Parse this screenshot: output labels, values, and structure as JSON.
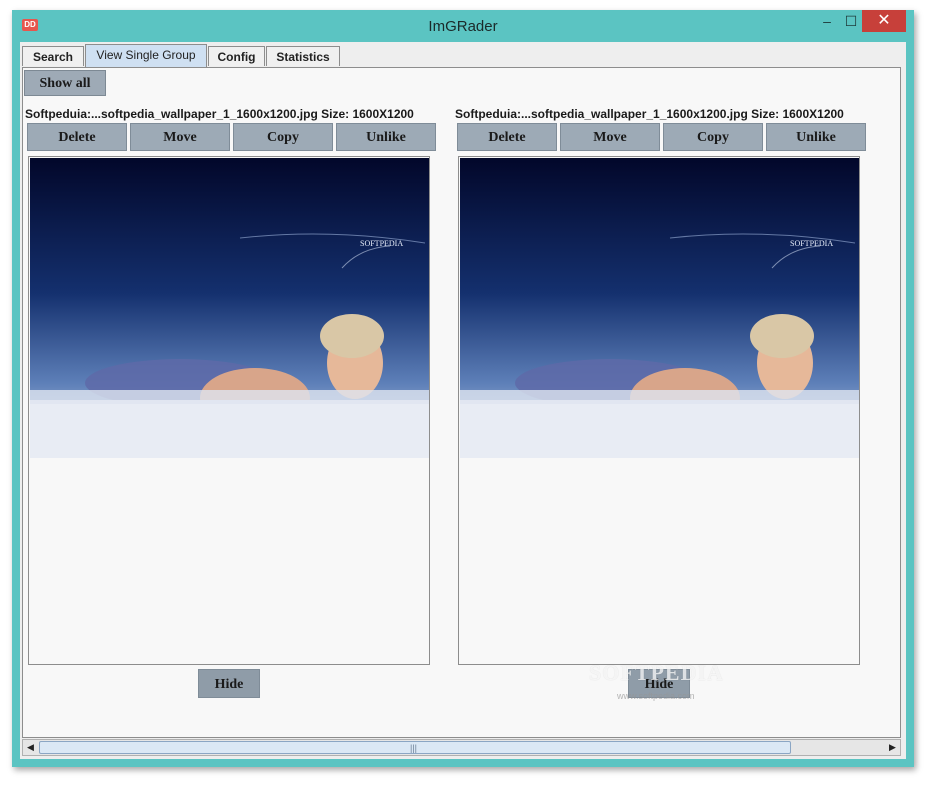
{
  "window": {
    "title": "ImGRader",
    "app_icon_text": "DD",
    "minimize_icon": "minimize-icon",
    "maximize_icon": "maximize-icon",
    "close_icon": "close-icon",
    "minimize_glyph": "–",
    "maximize_glyph": "☐",
    "close_glyph": "✕"
  },
  "tabs": [
    {
      "label": "Search",
      "active": false
    },
    {
      "label": "View Single Group",
      "active": true
    },
    {
      "label": "Config",
      "active": false
    },
    {
      "label": "Statistics",
      "active": false
    }
  ],
  "toolbar": {
    "show_all_label": "Show all"
  },
  "left": {
    "info": "Softpeduia:...softpedia_wallpaper_1_1600x1200.jpg  Size: 1600X1200",
    "buttons": [
      "Delete",
      "Move",
      "Copy",
      "Unlike"
    ],
    "hide_label": "Hide",
    "image_text": "SOFTPEDIA"
  },
  "right": {
    "info": "Softpeduia:...softpedia_wallpaper_1_1600x1200.jpg  Size: 1600X1200",
    "buttons": [
      "Delete",
      "Move",
      "Copy",
      "Unlike"
    ],
    "hide_label": "Hide",
    "image_text": "SOFTPEDIA"
  },
  "watermark": {
    "text": "SOFTPEDIA",
    "sub": "www.softpedia.com"
  },
  "scrollbar": {
    "left_arrow": "◀",
    "right_arrow": "▶",
    "grip": "|||"
  },
  "colors": {
    "frame": "#5bc4c2",
    "close": "#c7403a",
    "button": "#9daab6",
    "active_tab": "#cfe0f2"
  }
}
